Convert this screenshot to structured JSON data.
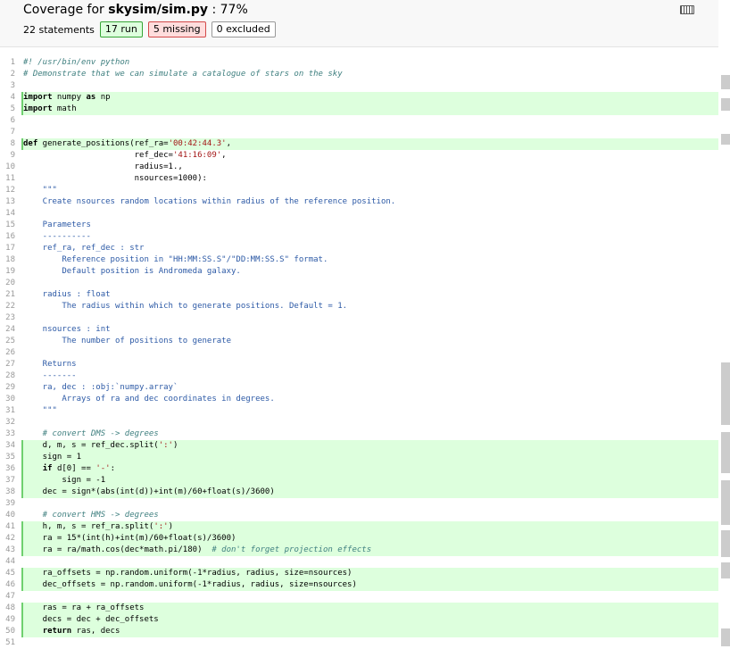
{
  "header": {
    "title_prefix": "Coverage for ",
    "file_name": "skysim/sim.py",
    "title_suffix": " : 77%",
    "statements": "22 statements",
    "run": "17 run",
    "missing": "5 missing",
    "excluded": "0 excluded",
    "keyboard_icon": "keyboard-icon"
  },
  "lines": [
    {
      "n": "1",
      "t": "#! /usr/bin/env python",
      "r": false
    },
    {
      "n": "2",
      "t": "# Demonstrate that we can simulate a catalogue of stars on the sky",
      "r": false
    },
    {
      "n": "3",
      "t": "",
      "r": false
    },
    {
      "n": "4",
      "t": "import numpy as np",
      "r": true
    },
    {
      "n": "5",
      "t": "import math",
      "r": true
    },
    {
      "n": "6",
      "t": "",
      "r": false
    },
    {
      "n": "7",
      "t": "",
      "r": false
    },
    {
      "n": "8",
      "t": "def generate_positions(ref_ra='00:42:44.3',",
      "r": true
    },
    {
      "n": "9",
      "t": "                       ref_dec='41:16:09',",
      "r": false
    },
    {
      "n": "10",
      "t": "                       radius=1.,",
      "r": false
    },
    {
      "n": "11",
      "t": "                       nsources=1000):",
      "r": false
    },
    {
      "n": "12",
      "t": "    \"\"\"",
      "r": false
    },
    {
      "n": "13",
      "t": "    Create nsources random locations within radius of the reference position.",
      "r": false
    },
    {
      "n": "14",
      "t": "",
      "r": false
    },
    {
      "n": "15",
      "t": "    Parameters",
      "r": false
    },
    {
      "n": "16",
      "t": "    ----------",
      "r": false
    },
    {
      "n": "17",
      "t": "    ref_ra, ref_dec : str",
      "r": false
    },
    {
      "n": "18",
      "t": "        Reference position in \"HH:MM:SS.S\"/\"DD:MM:SS.S\" format.",
      "r": false
    },
    {
      "n": "19",
      "t": "        Default position is Andromeda galaxy.",
      "r": false
    },
    {
      "n": "20",
      "t": "",
      "r": false
    },
    {
      "n": "21",
      "t": "    radius : float",
      "r": false
    },
    {
      "n": "22",
      "t": "        The radius within which to generate positions. Default = 1.",
      "r": false
    },
    {
      "n": "23",
      "t": "",
      "r": false
    },
    {
      "n": "24",
      "t": "    nsources : int",
      "r": false
    },
    {
      "n": "25",
      "t": "        The number of positions to generate",
      "r": false
    },
    {
      "n": "26",
      "t": "",
      "r": false
    },
    {
      "n": "27",
      "t": "    Returns",
      "r": false
    },
    {
      "n": "28",
      "t": "    -------",
      "r": false
    },
    {
      "n": "29",
      "t": "    ra, dec : :obj:`numpy.array`",
      "r": false
    },
    {
      "n": "30",
      "t": "        Arrays of ra and dec coordinates in degrees.",
      "r": false
    },
    {
      "n": "31",
      "t": "    \"\"\"",
      "r": false
    },
    {
      "n": "32",
      "t": "",
      "r": false
    },
    {
      "n": "33",
      "t": "    # convert DMS -> degrees",
      "r": false
    },
    {
      "n": "34",
      "t": "    d, m, s = ref_dec.split(':')",
      "r": true
    },
    {
      "n": "35",
      "t": "    sign = 1",
      "r": true
    },
    {
      "n": "36",
      "t": "    if d[0] == '-':",
      "r": true
    },
    {
      "n": "37",
      "t": "        sign = -1",
      "r": true
    },
    {
      "n": "38",
      "t": "    dec = sign*(abs(int(d))+int(m)/60+float(s)/3600)",
      "r": true
    },
    {
      "n": "39",
      "t": "",
      "r": false
    },
    {
      "n": "40",
      "t": "    # convert HMS -> degrees",
      "r": false
    },
    {
      "n": "41",
      "t": "    h, m, s = ref_ra.split(':')",
      "r": true
    },
    {
      "n": "42",
      "t": "    ra = 15*(int(h)+int(m)/60+float(s)/3600)",
      "r": true
    },
    {
      "n": "43",
      "t": "    ra = ra/math.cos(dec*math.pi/180)  # don't forget projection effects",
      "r": true
    },
    {
      "n": "44",
      "t": "",
      "r": false
    },
    {
      "n": "45",
      "t": "    ra_offsets = np.random.uniform(-1*radius, radius, size=nsources)",
      "r": true
    },
    {
      "n": "46",
      "t": "    dec_offsets = np.random.uniform(-1*radius, radius, size=nsources)",
      "r": true
    },
    {
      "n": "47",
      "t": "",
      "r": false
    },
    {
      "n": "48",
      "t": "    ras = ra + ra_offsets",
      "r": true
    },
    {
      "n": "49",
      "t": "    decs = dec + dec_offsets",
      "r": true
    },
    {
      "n": "50",
      "t": "    return ras, decs",
      "r": true
    },
    {
      "n": "51",
      "t": "",
      "r": false
    }
  ]
}
